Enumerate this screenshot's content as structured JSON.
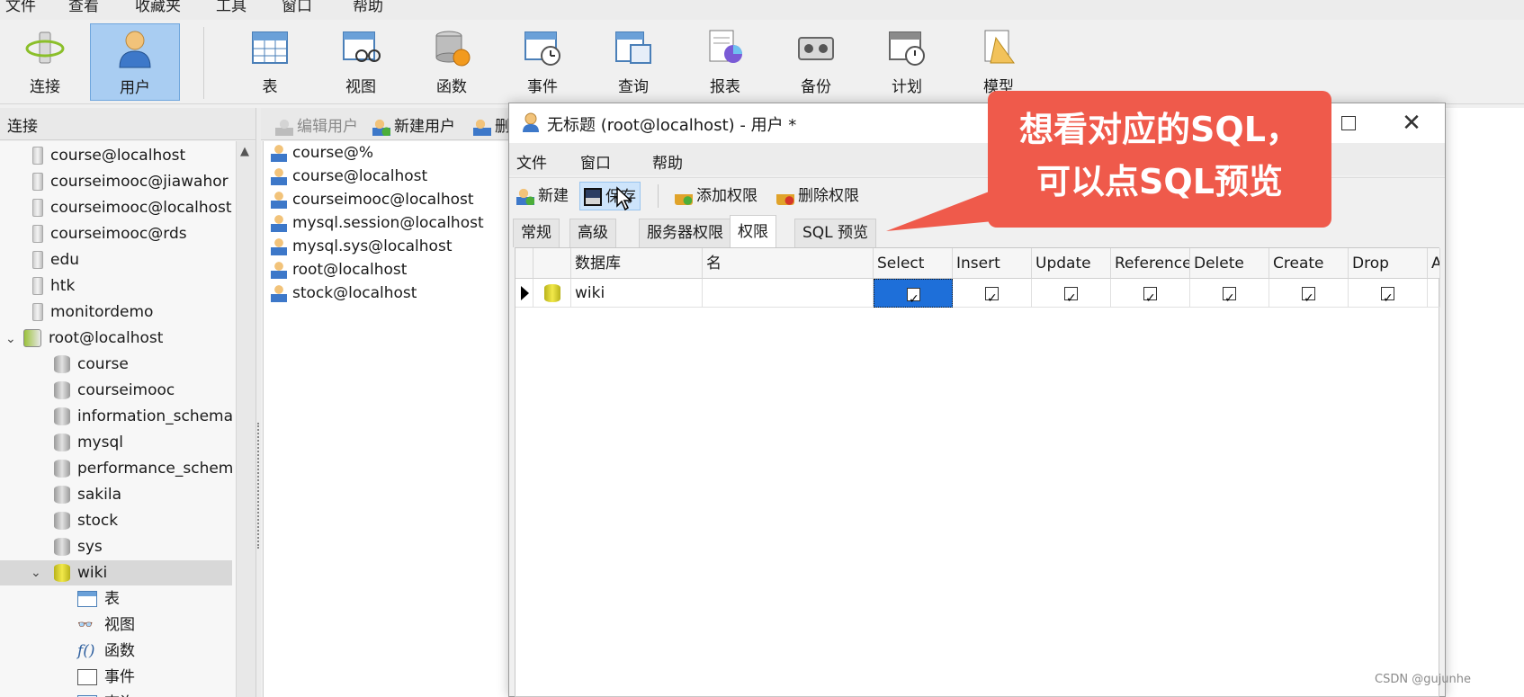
{
  "menubar": {
    "items": [
      "文件",
      "查看",
      "收藏夹",
      "工具",
      "窗口",
      "帮助"
    ]
  },
  "toolbar": {
    "items": [
      {
        "label": "连接",
        "icon": "connection-icon"
      },
      {
        "label": "用户",
        "icon": "user-icon",
        "active": true
      },
      {
        "label": "表",
        "icon": "table-icon"
      },
      {
        "label": "视图",
        "icon": "view-icon"
      },
      {
        "label": "函数",
        "icon": "function-icon"
      },
      {
        "label": "事件",
        "icon": "event-icon"
      },
      {
        "label": "查询",
        "icon": "query-icon"
      },
      {
        "label": "报表",
        "icon": "report-icon"
      },
      {
        "label": "备份",
        "icon": "backup-icon"
      },
      {
        "label": "计划",
        "icon": "schedule-icon"
      },
      {
        "label": "模型",
        "icon": "model-icon"
      }
    ]
  },
  "connections": {
    "header": "连接",
    "items": [
      {
        "label": "course@localhost"
      },
      {
        "label": "courseimooc@jiawahor"
      },
      {
        "label": "courseimooc@localhost"
      },
      {
        "label": "courseimooc@rds"
      },
      {
        "label": "edu"
      },
      {
        "label": "htk"
      },
      {
        "label": "monitordemo"
      },
      {
        "label": "root@localhost"
      },
      {
        "label": "course"
      },
      {
        "label": "courseimooc"
      },
      {
        "label": "information_schema"
      },
      {
        "label": "mysql"
      },
      {
        "label": "performance_schem"
      },
      {
        "label": "sakila"
      },
      {
        "label": "stock"
      },
      {
        "label": "sys"
      },
      {
        "label": "wiki"
      },
      {
        "label": "表"
      },
      {
        "label": "视图"
      },
      {
        "label": "函数"
      },
      {
        "label": "事件"
      },
      {
        "label": "查询"
      }
    ]
  },
  "users_toolbar": {
    "edit": "编辑用户",
    "new": "新建用户",
    "delete": "删"
  },
  "users": [
    "course@%",
    "course@localhost",
    "courseimooc@localhost",
    "mysql.session@localhost",
    "mysql.sys@localhost",
    "root@localhost",
    "stock@localhost"
  ],
  "dialog": {
    "title": "无标题 (root@localhost) - 用户 *",
    "menu": [
      "文件",
      "窗口",
      "帮助"
    ],
    "tools": {
      "new": "新建",
      "save": "保存",
      "add_priv": "添加权限",
      "del_priv": "删除权限"
    },
    "tabs": [
      "常规",
      "高级",
      "服务器权限",
      "权限",
      "SQL 预览"
    ],
    "active_tab": "权限",
    "grid": {
      "columns": [
        "数据库",
        "名",
        "Select",
        "Insert",
        "Update",
        "Reference",
        "Delete",
        "Create",
        "Drop",
        "A"
      ],
      "rows": [
        {
          "database": "wiki",
          "name": "",
          "select": true,
          "insert": true,
          "update": true,
          "reference": true,
          "delete": true,
          "create": true,
          "drop": true
        }
      ]
    }
  },
  "callout": {
    "line1": "想看对应的SQL，",
    "line2": "可以点SQL预览"
  },
  "watermark": "CSDN @gujunhe",
  "colors": {
    "accent": "#1e6fd9",
    "callout": "#ef5a4b",
    "active_tool": "#a9cdf2"
  }
}
